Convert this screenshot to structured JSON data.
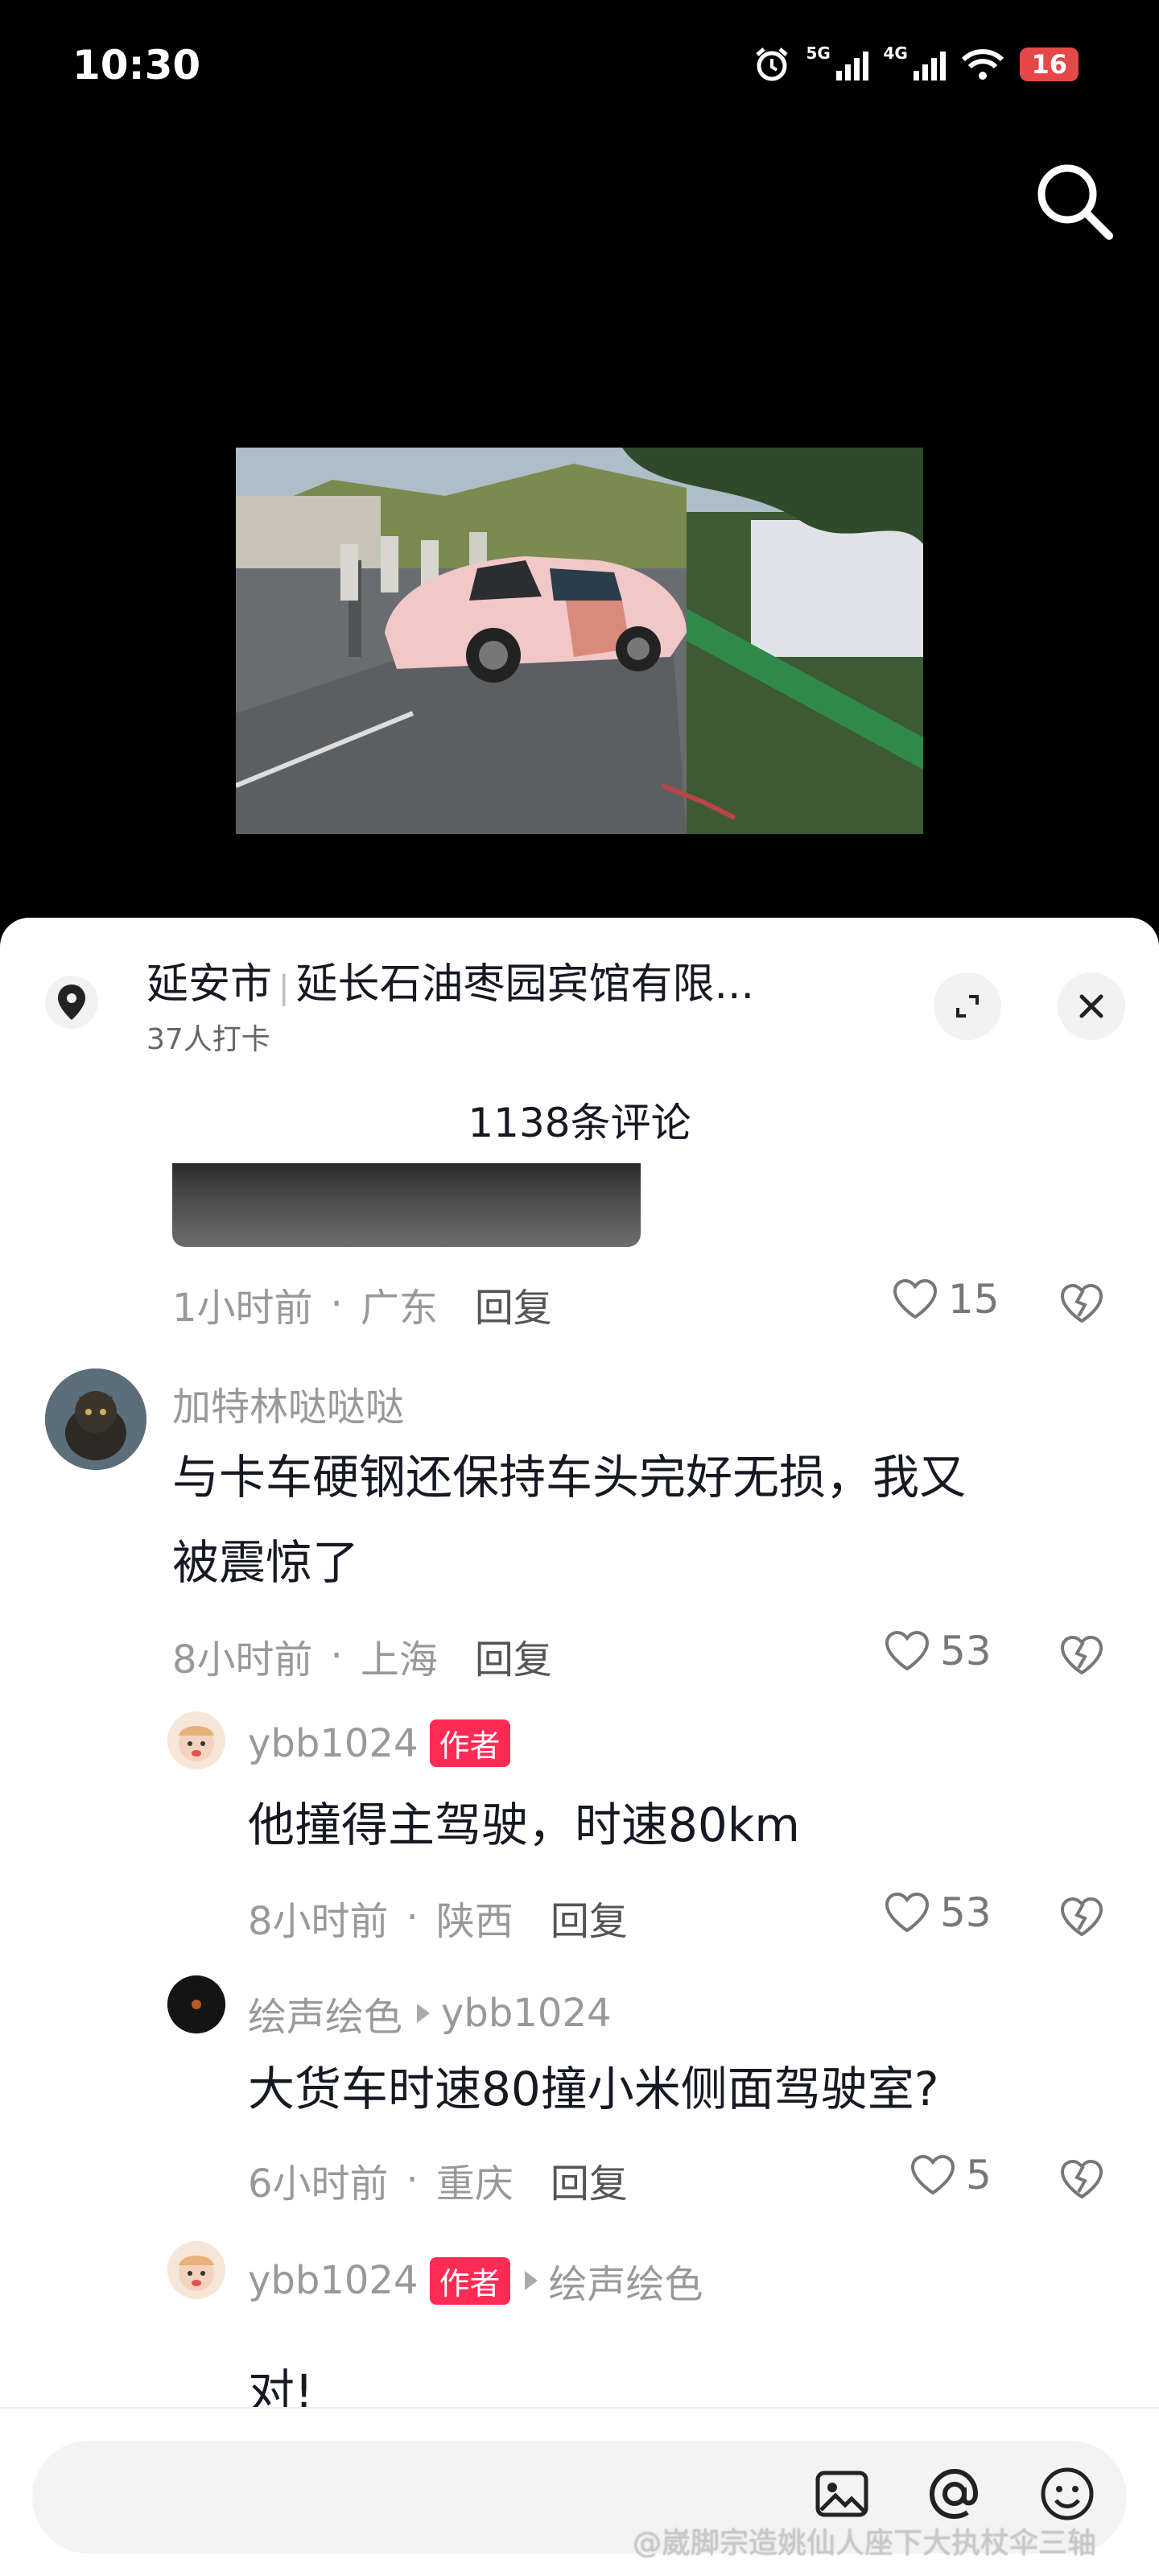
{
  "status_bar": {
    "time": "10:30",
    "net1": "5G",
    "net2": "4G",
    "battery": "16"
  },
  "location": {
    "city": "延安市",
    "place": "延长石油枣园宾馆有限...",
    "checkins": "37人打卡"
  },
  "comment_count": "1138条评论",
  "comments": [
    {
      "time": "1小时前",
      "region": "广东",
      "reply_label": "回复",
      "likes": "15"
    },
    {
      "user": "加特林哒哒哒",
      "text_line1": "与卡车硬钢还保持车头完好无损，我又",
      "text_line2": "被震惊了",
      "time": "8小时前",
      "region": "上海",
      "reply_label": "回复",
      "likes": "53"
    },
    {
      "user": "ybb1024",
      "tag": "作者",
      "text": "他撞得主驾驶，时速80km",
      "time": "8小时前",
      "region": "陕西",
      "reply_label": "回复",
      "likes": "53"
    },
    {
      "user": "绘声绘色",
      "reply_to": "ybb1024",
      "text": "大货车时速80撞小米侧面驾驶室?",
      "time": "6小时前",
      "region": "重庆",
      "reply_label": "回复",
      "likes": "5"
    },
    {
      "user": "ybb1024",
      "tag": "作者",
      "reply_to": "绘声绘色",
      "text": "对!"
    }
  ],
  "watermark": "@崴脚宗造姚仙人座下大执杖伞三轴",
  "icons": [
    "search-icon",
    "location-pin-icon",
    "expand-icon",
    "close-icon",
    "heart-icon",
    "dislike-heart-icon",
    "image-icon",
    "at-icon",
    "emoji-icon"
  ],
  "colors": {
    "accent": "#fe2c55",
    "text": "#161823",
    "meta": "#999999"
  }
}
